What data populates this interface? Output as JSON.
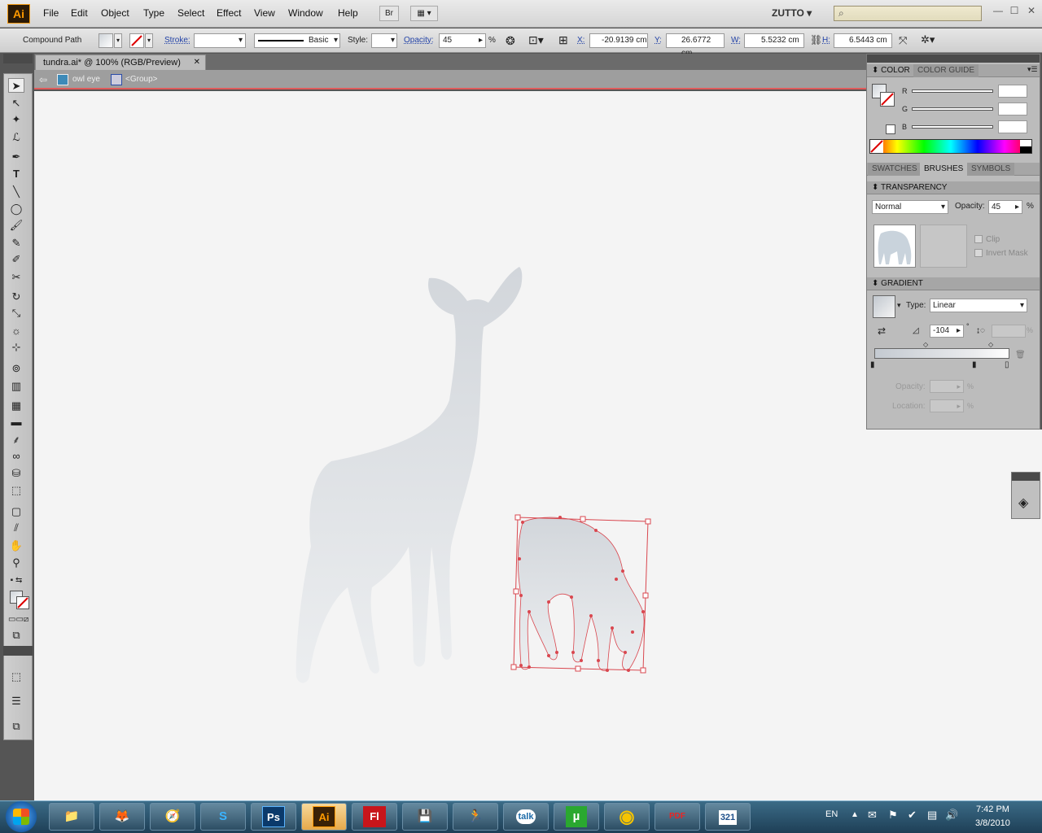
{
  "app": {
    "logo": "Ai"
  },
  "menu": [
    "File",
    "Edit",
    "Object",
    "Type",
    "Select",
    "Effect",
    "View",
    "Window",
    "Help"
  ],
  "bridge_button": "Br",
  "workspace": "ZUTTO",
  "control": {
    "selection_type": "Compound Path",
    "stroke_label": "Stroke:",
    "brush_label": "Basic",
    "style_label": "Style:",
    "opacity_label": "Opacity:",
    "opacity_value": "45",
    "percent": "%",
    "x_label": "X:",
    "x_value": "-20.9139 cm",
    "y_label": "Y:",
    "y_value": "26.6772 cm",
    "w_label": "W:",
    "w_value": "5.5232 cm",
    "h_label": "H:",
    "h_value": "6.5443 cm"
  },
  "document": {
    "tab_title": "tundra.ai* @ 100% (RGB/Preview)",
    "close": "✕"
  },
  "breadcrumb": {
    "layer": "owl eye",
    "group": "<Group>"
  },
  "panels": {
    "color": {
      "tab1": "COLOR",
      "tab2": "COLOR GUIDE",
      "r": "R",
      "g": "G",
      "b": "B"
    },
    "swatches": {
      "tab1": "SWATCHES",
      "tab2": "BRUSHES",
      "tab3": "SYMBOLS"
    },
    "transparency": {
      "title": "TRANSPARENCY",
      "blend": "Normal",
      "opacity_label": "Opacity:",
      "opacity_value": "45",
      "percent": "%",
      "clip": "Clip",
      "invert_mask": "Invert Mask"
    },
    "gradient": {
      "title": "GRADIENT",
      "type_label": "Type:",
      "type_value": "Linear",
      "angle_value": "-104",
      "degree": "°",
      "opacity_label": "Opacity:",
      "location_label": "Location:",
      "percent": "%"
    }
  },
  "taskbar": {
    "items": [
      "📁",
      "🦊",
      "🧭",
      "S",
      "Ps",
      "Ai",
      "Fl",
      "💾",
      "🏃",
      "talk",
      "µ",
      "◉",
      "PDF",
      "321"
    ],
    "lang": "EN",
    "time": "7:42 PM",
    "date": "3/8/2010"
  },
  "colors": {
    "accent": "#ff9a00",
    "selection": "#d9474f",
    "deer": "#d9dde1"
  }
}
